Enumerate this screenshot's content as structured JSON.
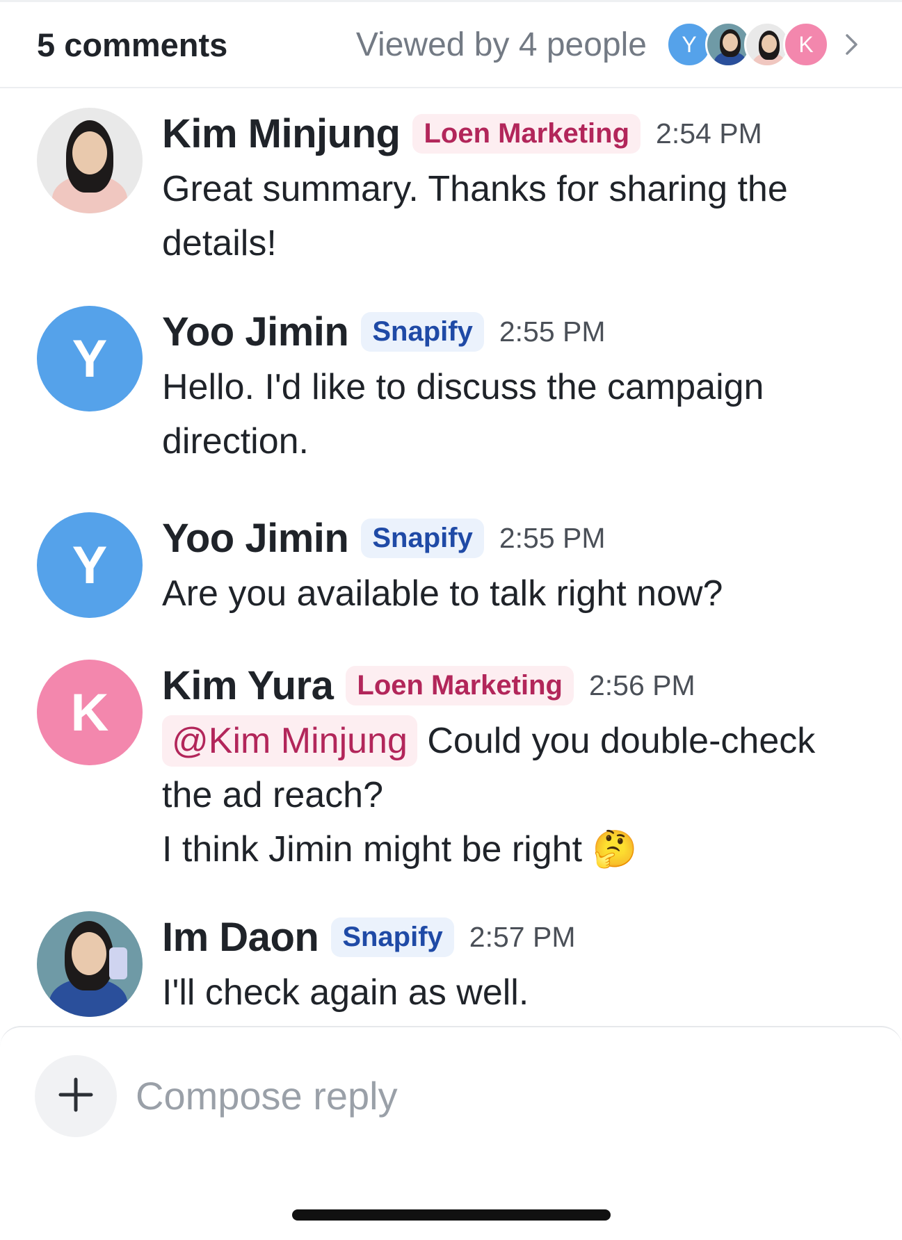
{
  "header": {
    "comment_count": "5 comments",
    "viewed_by": "Viewed by 4 people",
    "viewers": [
      {
        "initial": "Y",
        "color": "#55a2ea",
        "type": "initial"
      },
      {
        "initial": "",
        "color": "#6f9aa6",
        "type": "photo"
      },
      {
        "initial": "",
        "color": "#e9e9e9",
        "type": "photo"
      },
      {
        "initial": "K",
        "color": "#f387ad",
        "type": "initial"
      }
    ]
  },
  "comments": [
    {
      "author": "Kim Minjung",
      "org": "Loen Marketing",
      "time": "2:54 PM",
      "text": "Great summary. Thanks for sharing the details!",
      "avatar_type": "photo"
    },
    {
      "author": "Yoo Jimin",
      "org": "Snapify",
      "time": "2:55 PM",
      "text": "Hello. I'd like to discuss the campaign direction.",
      "avatar_initial": "Y",
      "avatar_color": "#55a2ea"
    },
    {
      "author": "Yoo Jimin",
      "org": "Snapify",
      "time": "2:55 PM",
      "text": "Are you available to talk right now?",
      "avatar_initial": "Y",
      "avatar_color": "#55a2ea"
    },
    {
      "author": "Kim Yura",
      "org": "Loen Marketing",
      "time": "2:56 PM",
      "mention": "@Kim Minjung",
      "text": "Could you double-check the ad reach?",
      "text2": "I think Jimin might be right 🤔",
      "avatar_initial": "K",
      "avatar_color": "#f387ad"
    },
    {
      "author": "Im Daon",
      "org": "Snapify",
      "time": "2:57 PM",
      "text": "I'll check again as well.",
      "avatar_type": "photo"
    }
  ],
  "composer": {
    "placeholder": "Compose reply"
  },
  "colors": {
    "loen_badge_bg": "#fdeef1",
    "loen_badge_text": "#b2265a",
    "snapify_badge_bg": "#ebf2fc",
    "snapify_badge_text": "#1f4aa6"
  }
}
